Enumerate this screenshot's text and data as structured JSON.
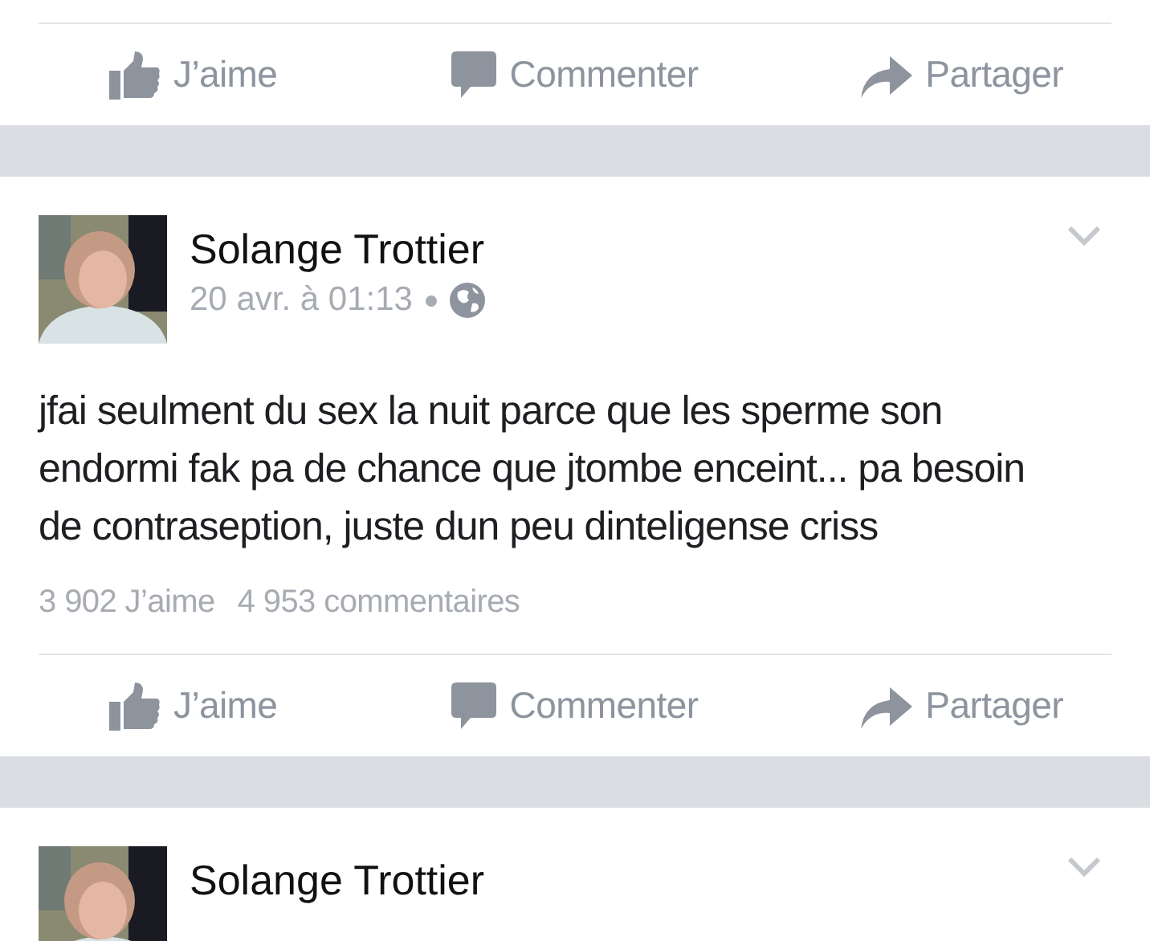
{
  "feed": [
    {
      "kind": "actions",
      "actions": [
        {
          "kind": "like",
          "label": "J’aime"
        },
        {
          "kind": "comment",
          "label": "Commenter"
        },
        {
          "kind": "share",
          "label": "Partager"
        }
      ]
    },
    {
      "kind": "post",
      "author": "Solange Trottier",
      "time": "20 avr. à 01:13",
      "public": true,
      "text": "jfai seulment du sex la nuit parce que les sperme son endormi fak pa de chance que jtombe enceint... pa besoin de contraseption, juste dun peu dinteligense criss",
      "likes": "3 902 J’aime",
      "comments": "4 953 commentaires",
      "actions": [
        {
          "kind": "like",
          "label": "J’aime"
        },
        {
          "kind": "comment",
          "label": "Commenter"
        },
        {
          "kind": "share",
          "label": "Partager"
        }
      ]
    },
    {
      "kind": "post",
      "author": "Solange Trottier"
    }
  ]
}
